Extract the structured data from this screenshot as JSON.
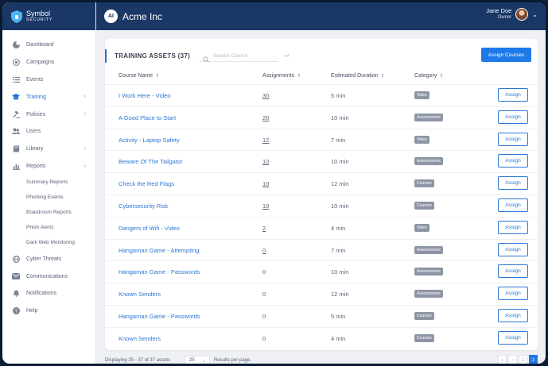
{
  "brand": {
    "name": "Symbol",
    "sub": "SECURITY"
  },
  "header": {
    "org_initials": "AI",
    "org_name": "Acme Inc",
    "user_name": "Jane Doe",
    "user_role": "Owner"
  },
  "sidebar": {
    "items": [
      {
        "label": "Dashboard",
        "icon": "dashboard-icon"
      },
      {
        "label": "Campaigns",
        "icon": "target-icon"
      },
      {
        "label": "Events",
        "icon": "list-icon"
      },
      {
        "label": "Training",
        "icon": "graduation-cap-icon",
        "active": true,
        "chevron": true
      },
      {
        "label": "Policies",
        "icon": "gavel-icon",
        "chevron": true
      },
      {
        "label": "Users",
        "icon": "users-icon"
      },
      {
        "label": "Library",
        "icon": "book-icon",
        "chevron": true
      },
      {
        "label": "Reports",
        "icon": "bar-chart-icon",
        "chevron": true
      }
    ],
    "report_subitems": [
      "Summary Reports",
      "Phishing Events",
      "Boardroom Reports",
      "Phish Alerts",
      "Dark Web Monitoring"
    ],
    "bottom_items": [
      {
        "label": "Cyber Threats",
        "icon": "globe-icon"
      },
      {
        "label": "Communications",
        "icon": "envelope-icon"
      },
      {
        "label": "Notifications",
        "icon": "bell-icon"
      },
      {
        "label": "Help",
        "icon": "help-icon"
      }
    ]
  },
  "main": {
    "title": "TRAINING ASSETS (37)",
    "search_placeholder": "Search Course",
    "assign_courses_label": "Assign Courses",
    "columns": {
      "name": "Course Name",
      "assignments": "Assignments",
      "duration": "Estimated Duration",
      "category": "Category"
    },
    "assign_label": "Assign",
    "rows": [
      {
        "name": "I Work Here - Video",
        "assignments": "30",
        "link": true,
        "duration": "5 min",
        "category": "Video"
      },
      {
        "name": "A Good Place to Start",
        "assignments": "20",
        "link": true,
        "duration": "10 min",
        "category": "Assessments"
      },
      {
        "name": "Activity - Laptop Safety",
        "assignments": "12",
        "link": true,
        "duration": "7 min",
        "category": "Video"
      },
      {
        "name": "Beware Of The Tailgator",
        "assignments": "10",
        "link": true,
        "duration": "10 min",
        "category": "Assessments"
      },
      {
        "name": "Check the Red Flags",
        "assignments": "10",
        "link": true,
        "duration": "12 min",
        "category": "Courses"
      },
      {
        "name": "Cybersecurity Risk",
        "assignments": "10",
        "link": true,
        "duration": "10 min",
        "category": "Courses"
      },
      {
        "name": "Dangers of Wifi - Video",
        "assignments": "2",
        "link": true,
        "duration": "4 min",
        "category": "Video"
      },
      {
        "name": "Hangaman Game - Attempting",
        "assignments": "0",
        "link": true,
        "duration": "7 min",
        "category": "Assessments"
      },
      {
        "name": "Hangaman Game - Passwords",
        "assignments": "0",
        "link": false,
        "duration": "10 min",
        "category": "Assessments"
      },
      {
        "name": "Known Senders",
        "assignments": "0",
        "link": false,
        "duration": "12 min",
        "category": "Assessments"
      },
      {
        "name": "Hangaman Game - Passwords",
        "assignments": "0",
        "link": false,
        "duration": "5 min",
        "category": "Courses"
      },
      {
        "name": "Known Senders",
        "assignments": "0",
        "link": false,
        "duration": "4 min",
        "category": "Courses"
      }
    ]
  },
  "footer": {
    "displaying": "Displaying 25 - 37 of 37 assets",
    "per_page_value": "25",
    "per_page_label": "Results per page.",
    "pages": [
      "«",
      "‹",
      "1",
      "2"
    ],
    "current_page": "2"
  },
  "colors": {
    "navy": "#1a3766",
    "primary": "#1e7ae8",
    "link": "#2c78d4",
    "badge": "#8d95a5"
  }
}
